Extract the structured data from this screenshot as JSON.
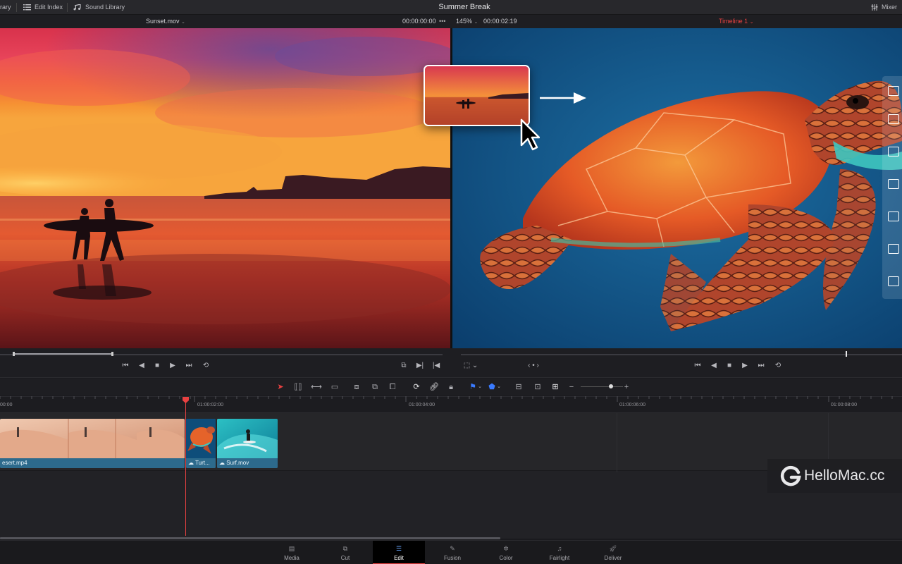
{
  "topbar": {
    "left_partial": "rary",
    "edit_index": "Edit Index",
    "sound_library": "Sound Library",
    "app_title": "Summer Break",
    "mixer": "Mixer"
  },
  "viewer_header": {
    "source_clip": "Sunset.mov",
    "source_timecode": "00:00:00:00",
    "zoom": "145%",
    "timeline_timecode": "00:00:02:19",
    "timeline_name": "Timeline 1"
  },
  "ruler": {
    "timecodes": [
      "00:00",
      "01:00:02:00",
      "01:00:04:00",
      "01:00:06:00",
      "01:00:08:00"
    ]
  },
  "clips": [
    {
      "label": "esert.mp4"
    },
    {
      "label": "Turt..."
    },
    {
      "label": "Surf.mov"
    }
  ],
  "page_tabs": [
    {
      "label": "Media",
      "icon": "media-icon"
    },
    {
      "label": "Cut",
      "icon": "cut-icon"
    },
    {
      "label": "Edit",
      "icon": "edit-icon"
    },
    {
      "label": "Fusion",
      "icon": "fusion-icon"
    },
    {
      "label": "Color",
      "icon": "color-icon"
    },
    {
      "label": "Fairlight",
      "icon": "fairlight-icon"
    },
    {
      "label": "Deliver",
      "icon": "deliver-icon"
    }
  ],
  "active_tab": "Edit",
  "watermark": "HelloMac.cc",
  "colors": {
    "accent_red": "#e84141",
    "clip_blue": "#2d6a8c",
    "background": "#1a1a1e"
  }
}
